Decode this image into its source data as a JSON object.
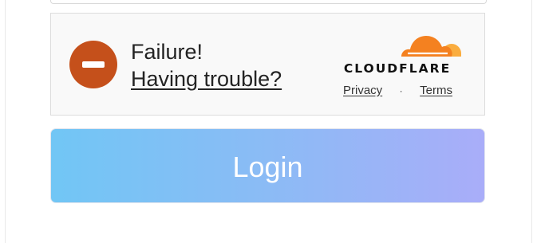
{
  "widget": {
    "status": "Failure!",
    "help_link": "Having trouble?",
    "brand": {
      "name": "CLOUDFLARE",
      "logo_icon": "cloudflare-cloud-icon",
      "colors": {
        "cloud_main": "#f48120",
        "cloud_accent": "#faad3f"
      }
    },
    "footer": {
      "privacy": "Privacy",
      "separator": "·",
      "terms": "Terms"
    },
    "status_icon": "failure-circle-icon",
    "status_color": "#c5501b"
  },
  "login_button": {
    "label": "Login",
    "gradient_start": "#71c6f5",
    "gradient_end": "#a9adf9"
  }
}
